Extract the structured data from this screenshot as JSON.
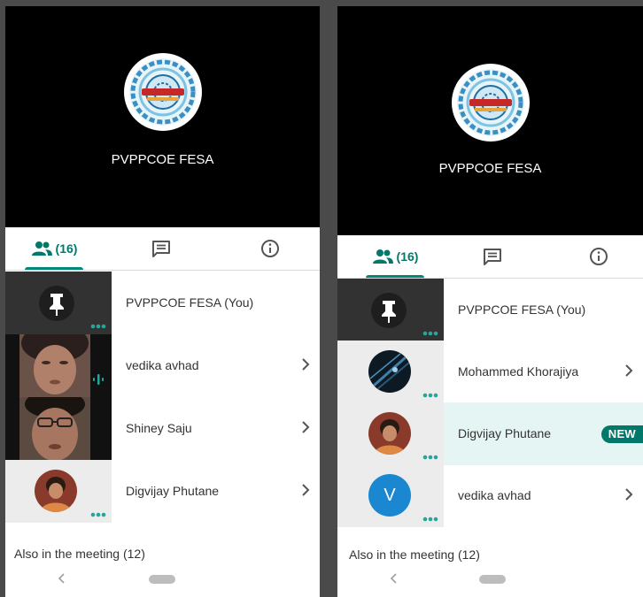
{
  "panel_left": {
    "meeting_title": "PVPPCOE FESA",
    "people_count": "(16)",
    "participants": [
      {
        "name": "PVPPCOE FESA (You)"
      },
      {
        "name": "vedika avhad"
      },
      {
        "name": "Shiney Saju"
      },
      {
        "name": "Digvijay Phutane"
      }
    ],
    "also_in_meeting": "Also in the meeting (12)"
  },
  "panel_right": {
    "meeting_title": "PVPPCOE FESA",
    "people_count": "(16)",
    "participants": [
      {
        "name": "PVPPCOE FESA (You)"
      },
      {
        "name": "Mohammed Khorajiya"
      },
      {
        "name": "Digvijay Phutane",
        "badge": "NEW"
      },
      {
        "name": "vedika avhad",
        "avatar_letter": "V"
      }
    ],
    "also_in_meeting": "Also in the meeting (12)"
  },
  "icons": {
    "people": "people-icon",
    "chat": "chat-icon",
    "info": "info-icon",
    "pin": "pin-icon",
    "more": "more-dots-icon",
    "chevron": "chevron-right-icon",
    "audio": "audio-level-icon",
    "back": "nav-back-icon"
  },
  "colors": {
    "accent": "#00796b",
    "accent_light": "#26a69a",
    "highlight": "#e5f5f3",
    "avatar_blue": "#1a87d0"
  }
}
